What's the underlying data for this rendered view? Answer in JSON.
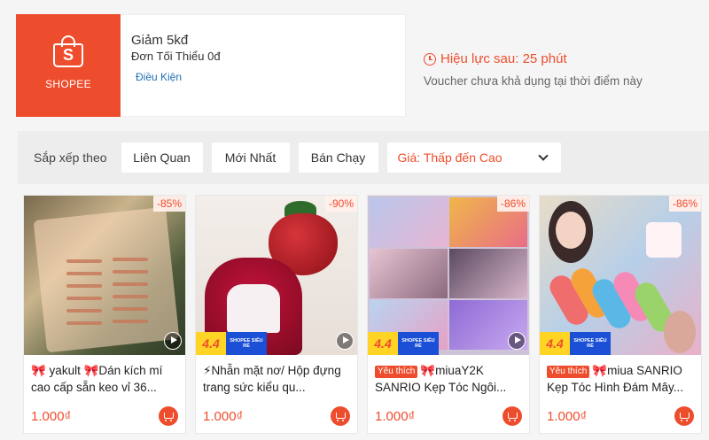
{
  "voucher": {
    "brand": "SHOPEE",
    "title": "Giảm 5kđ",
    "min_order": "Đơn Tối Thiểu 0đ",
    "conditions_link": "Điều Kiện",
    "validity": "Hiệu lực sau: 25 phút",
    "note": "Voucher chưa khả dụng tại thời điểm này",
    "brand_color": "#ee4d2d"
  },
  "sort": {
    "label": "Sắp xếp theo",
    "options": [
      "Liên Quan",
      "Mới Nhất",
      "Bán Chạy"
    ],
    "price_select": "Giá: Thấp đến Cao"
  },
  "badges": {
    "sale_number": "4.4",
    "sale_text": "SHOPEE SIÊU RẺ",
    "favorite": "Yêu thích"
  },
  "products": [
    {
      "discount": "-85%",
      "title": "🎀 yakult 🎀Dán kích mí cao cấp sẵn keo vỉ 36...",
      "price": "1.000₫",
      "has_sale_badge": false,
      "favorite": false
    },
    {
      "discount": "-90%",
      "title": "⚡Nhẫn mặt nơ/ Hộp đựng trang sức kiểu qu...",
      "price": "1.000₫",
      "has_sale_badge": true,
      "favorite": false
    },
    {
      "discount": "-86%",
      "title": "🎀miuaY2K SANRIO Kẹp Tóc Ngôi...",
      "price": "1.000₫",
      "has_sale_badge": true,
      "favorite": true
    },
    {
      "discount": "-86%",
      "title": "🎀miua SANRIO Kẹp Tóc Hình Đám Mây...",
      "price": "1.000₫",
      "has_sale_badge": true,
      "favorite": true
    }
  ]
}
